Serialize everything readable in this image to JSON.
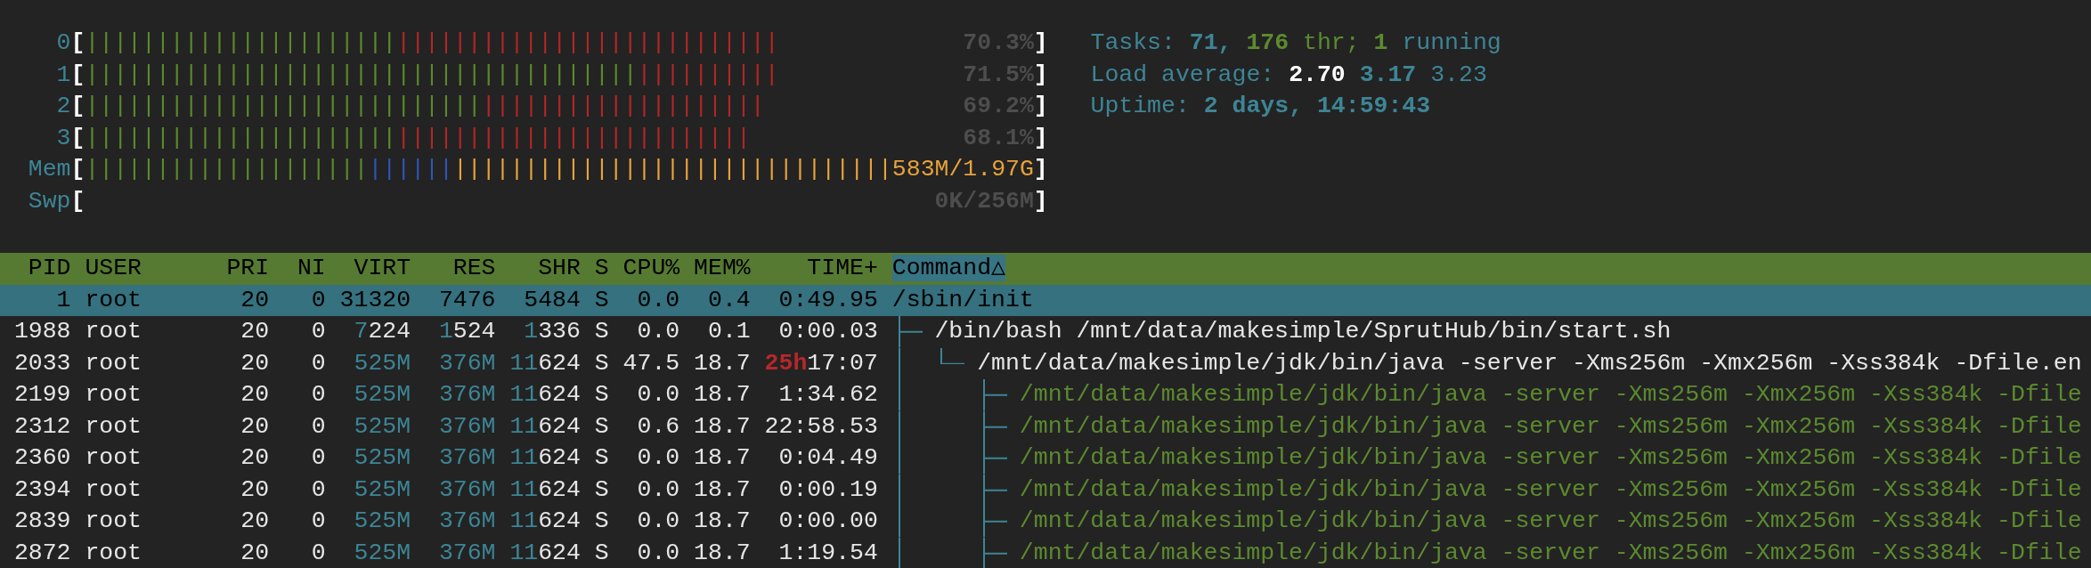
{
  "meters": [
    {
      "label": "0",
      "open": "[",
      "close": "]",
      "value": "70.3%",
      "segments": [
        {
          "color": "#5a8a2a",
          "text": "||||||||||||||||||||||"
        },
        {
          "color": "#b32626",
          "text": "|||||||||||||||||||||||||||"
        }
      ]
    },
    {
      "label": "1",
      "open": "[",
      "close": "]",
      "value": "71.5%",
      "segments": [
        {
          "color": "#5a8a2a",
          "text": "|||||||||||||||||||||||||||||||||||||||"
        },
        {
          "color": "#b32626",
          "text": "||||||||||"
        }
      ]
    },
    {
      "label": "2",
      "open": "[",
      "close": "]",
      "value": "69.2%",
      "segments": [
        {
          "color": "#5a8a2a",
          "text": "||||||||||||||||||||||||||||"
        },
        {
          "color": "#b32626",
          "text": "||||||||||||||||||||"
        }
      ]
    },
    {
      "label": "3",
      "open": "[",
      "close": "]",
      "value": "68.1%",
      "segments": [
        {
          "color": "#5a8a2a",
          "text": "||||||||||||||||||||||"
        },
        {
          "color": "#b32626",
          "text": "|||||||||||||||||||||||||"
        }
      ]
    },
    {
      "label": "Mem",
      "open": "[",
      "close": "]",
      "value": "583M/1.97G",
      "segments": [
        {
          "color": "#5a8a2a",
          "text": "||||||||||||||||||||"
        },
        {
          "color": "#2f55b8",
          "text": "||||||"
        },
        {
          "color": "#e9a23b",
          "text": "|||||||||||||||||||||||||||||||"
        }
      ]
    },
    {
      "label": "Swp",
      "open": "[",
      "close": "]",
      "value": "0K/256M"
    }
  ],
  "summary": [
    {
      "parts": [
        {
          "kind": "label",
          "text": "Tasks:"
        },
        {
          "kind": "count",
          "text": "71,"
        },
        {
          "kind": "threads",
          "text": "176"
        },
        {
          "kind": "thread_label",
          "text": "thr;"
        },
        {
          "kind": "running",
          "text": "1"
        },
        {
          "kind": "label",
          "text": "running"
        }
      ]
    },
    {
      "parts": [
        {
          "kind": "label",
          "text": "Load average:"
        },
        {
          "kind": "load_1",
          "text": "2.70"
        },
        {
          "kind": "load_5",
          "text": "3.17"
        },
        {
          "kind": "load_15",
          "text": "3.23"
        }
      ]
    },
    {
      "parts": [
        {
          "kind": "label",
          "text": "Uptime:"
        },
        {
          "kind": "count",
          "text": "2 days, 14:59:43"
        }
      ]
    }
  ],
  "table": {
    "columns": [
      {
        "label": "PID",
        "selected": false
      },
      {
        "label": "USER",
        "selected": false
      },
      {
        "label": "PRI",
        "selected": false
      },
      {
        "label": "NI",
        "selected": false
      },
      {
        "label": "VIRT",
        "selected": false
      },
      {
        "label": "RES",
        "selected": false
      },
      {
        "label": "SHR",
        "selected": false
      },
      {
        "label": "S",
        "selected": false
      },
      {
        "label": "CPU%",
        "selected": false
      },
      {
        "label": "MEM%",
        "selected": false
      },
      {
        "label": "TIME+",
        "selected": false
      },
      {
        "label": "Command△",
        "selected": true
      }
    ],
    "rows": [
      {
        "pid": "1",
        "user": "root",
        "pri": "20",
        "ni": "0",
        "virt": "31320",
        "res": "7476",
        "shr": "5484",
        "state": "S",
        "cpu": "0.0",
        "mem": "0.4",
        "time": "0:49.95",
        "command": "/sbin/init",
        "selected": true,
        "thread": false,
        "children": [
          {
            "pid": "1988",
            "user": "root",
            "pri": "20",
            "ni": "0",
            "virt": "7224",
            "res": "1524",
            "shr": "1336",
            "state": "S",
            "cpu": "0.0",
            "mem": "0.1",
            "time": "0:00.03",
            "command": "/bin/bash /mnt/data/makesimple/SprutHub/bin/start.sh",
            "selected": false,
            "thread": false,
            "last": false,
            "children": [
              {
                "pid": "2033",
                "user": "root",
                "pri": "20",
                "ni": "0",
                "virt": "525M",
                "res": "376M",
                "shr": "11624",
                "state": "S",
                "cpu": "47.5",
                "mem": "18.7",
                "time": "25h17:07",
                "command": "/mnt/data/makesimple/jdk/bin/java -server -Xms256m -Xmx256m -Xss384k -Dfile.en",
                "selected": false,
                "thread": false,
                "last": true,
                "children": [
                  {
                    "pid": "2199",
                    "user": "root",
                    "pri": "20",
                    "ni": "0",
                    "virt": "525M",
                    "res": "376M",
                    "shr": "11624",
                    "state": "S",
                    "cpu": "0.0",
                    "mem": "18.7",
                    "time": "1:34.62",
                    "command": "/mnt/data/makesimple/jdk/bin/java -server -Xms256m -Xmx256m -Xss384k -Dfile",
                    "selected": false,
                    "thread": true,
                    "last": false
                  },
                  {
                    "pid": "2312",
                    "user": "root",
                    "pri": "20",
                    "ni": "0",
                    "virt": "525M",
                    "res": "376M",
                    "shr": "11624",
                    "state": "S",
                    "cpu": "0.6",
                    "mem": "18.7",
                    "time": "22:58.53",
                    "command": "/mnt/data/makesimple/jdk/bin/java -server -Xms256m -Xmx256m -Xss384k -Dfile",
                    "selected": false,
                    "thread": true,
                    "last": false
                  },
                  {
                    "pid": "2360",
                    "user": "root",
                    "pri": "20",
                    "ni": "0",
                    "virt": "525M",
                    "res": "376M",
                    "shr": "11624",
                    "state": "S",
                    "cpu": "0.0",
                    "mem": "18.7",
                    "time": "0:04.49",
                    "command": "/mnt/data/makesimple/jdk/bin/java -server -Xms256m -Xmx256m -Xss384k -Dfile",
                    "selected": false,
                    "thread": true,
                    "last": false
                  },
                  {
                    "pid": "2394",
                    "user": "root",
                    "pri": "20",
                    "ni": "0",
                    "virt": "525M",
                    "res": "376M",
                    "shr": "11624",
                    "state": "S",
                    "cpu": "0.0",
                    "mem": "18.7",
                    "time": "0:00.19",
                    "command": "/mnt/data/makesimple/jdk/bin/java -server -Xms256m -Xmx256m -Xss384k -Dfile",
                    "selected": false,
                    "thread": true,
                    "last": false
                  },
                  {
                    "pid": "2839",
                    "user": "root",
                    "pri": "20",
                    "ni": "0",
                    "virt": "525M",
                    "res": "376M",
                    "shr": "11624",
                    "state": "S",
                    "cpu": "0.0",
                    "mem": "18.7",
                    "time": "0:00.00",
                    "command": "/mnt/data/makesimple/jdk/bin/java -server -Xms256m -Xmx256m -Xss384k -Dfile",
                    "selected": false,
                    "thread": true,
                    "last": false
                  },
                  {
                    "pid": "2872",
                    "user": "root",
                    "pri": "20",
                    "ni": "0",
                    "virt": "525M",
                    "res": "376M",
                    "shr": "11624",
                    "state": "S",
                    "cpu": "0.0",
                    "mem": "18.7",
                    "time": "1:19.54",
                    "command": "/mnt/data/makesimple/jdk/bin/java -server -Xms256m -Xmx256m -Xss384k -Dfile",
                    "selected": false,
                    "thread": true,
                    "last": false
                  }
                ]
              }
            ]
          }
        ]
      }
    ]
  }
}
